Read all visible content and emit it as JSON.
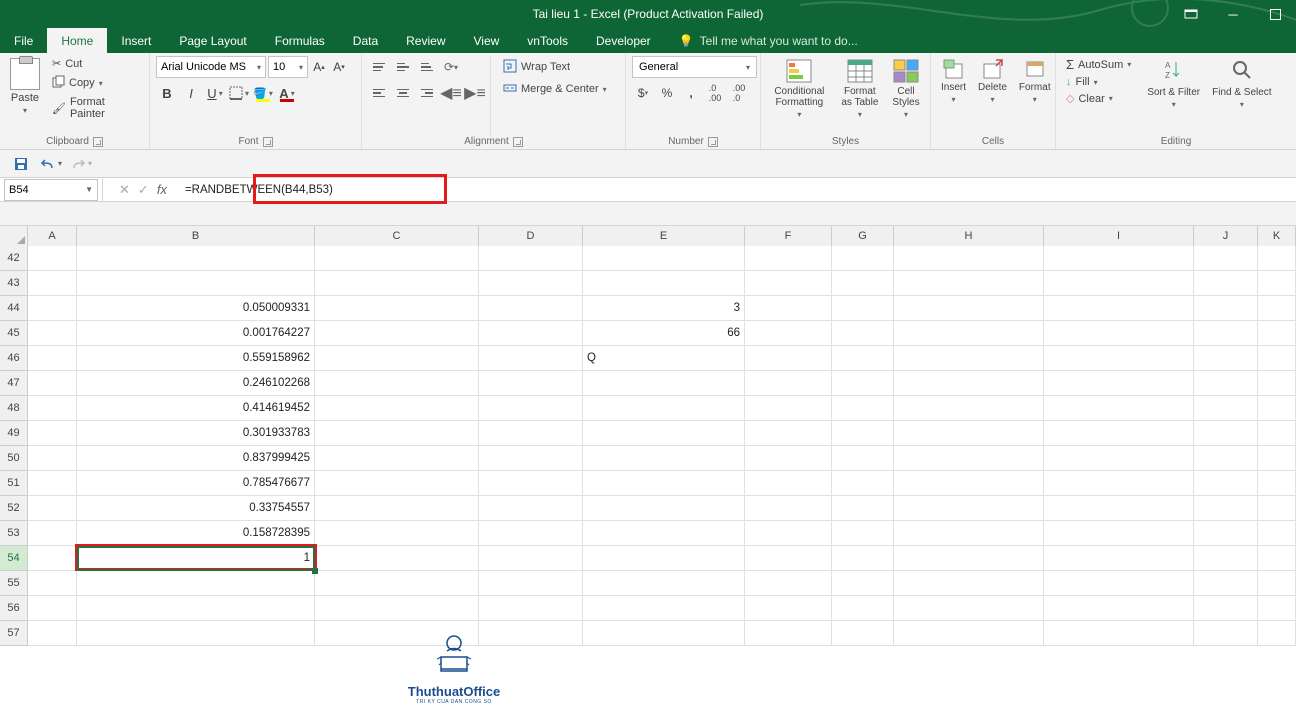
{
  "window": {
    "title": "Tai lieu 1 - Excel (Product Activation Failed)"
  },
  "menu": {
    "file": "File",
    "home": "Home",
    "insert": "Insert",
    "page_layout": "Page Layout",
    "formulas": "Formulas",
    "data": "Data",
    "review": "Review",
    "view": "View",
    "vntools": "vnTools",
    "developer": "Developer",
    "tell_me": "Tell me what you want to do..."
  },
  "ribbon": {
    "clipboard": {
      "label": "Clipboard",
      "paste": "Paste",
      "cut": "Cut",
      "copy": "Copy",
      "format_painter": "Format Painter"
    },
    "font": {
      "label": "Font",
      "name": "Arial Unicode MS",
      "size": "10"
    },
    "alignment": {
      "label": "Alignment",
      "wrap_text": "Wrap Text",
      "merge_center": "Merge & Center"
    },
    "number": {
      "label": "Number",
      "format": "General"
    },
    "styles": {
      "label": "Styles",
      "conditional": "Conditional Formatting",
      "table": "Format as Table",
      "cell": "Cell Styles"
    },
    "cells": {
      "label": "Cells",
      "insert": "Insert",
      "delete": "Delete",
      "format": "Format"
    },
    "editing": {
      "label": "Editing",
      "autosum": "AutoSum",
      "fill": "Fill",
      "clear": "Clear",
      "sort": "Sort & Filter",
      "find": "Find & Select"
    }
  },
  "namebox": "B54",
  "formula": "=RANDBETWEEN(B44,B53)",
  "columns": [
    "A",
    "B",
    "C",
    "D",
    "E",
    "F",
    "G",
    "H",
    "I",
    "J",
    "K"
  ],
  "rows": [
    "42",
    "43",
    "44",
    "45",
    "46",
    "47",
    "48",
    "49",
    "50",
    "51",
    "52",
    "53",
    "54",
    "55",
    "56",
    "57"
  ],
  "cells": {
    "B44": "0.050009331",
    "B45": "0.001764227",
    "B46": "0.559158962",
    "B47": "0.246102268",
    "B48": "0.414619452",
    "B49": "0.301933783",
    "B50": "0.837999425",
    "B51": "0.785476677",
    "B52": "0.33754557",
    "B53": "0.158728395",
    "B54": "1",
    "E44": "3",
    "E45": "66",
    "E46": "Q"
  },
  "watermark": {
    "text": "ThuthuatOffice",
    "sub": "TRI KY CUA DAN CONG SO"
  }
}
